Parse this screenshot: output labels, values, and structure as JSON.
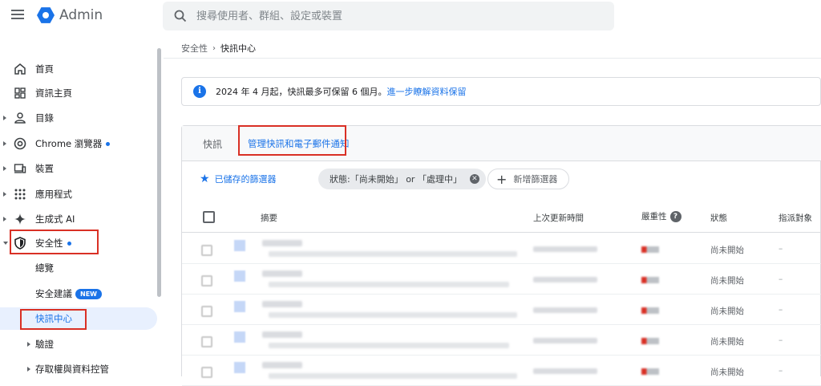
{
  "app": {
    "title": "Admin"
  },
  "search": {
    "placeholder": "搜尋使用者、群組、設定或裝置"
  },
  "sidebar": {
    "items": [
      {
        "label": "首頁"
      },
      {
        "label": "資訊主頁"
      },
      {
        "label": "目錄"
      },
      {
        "label": "Chrome 瀏覽器"
      },
      {
        "label": "裝置"
      },
      {
        "label": "應用程式"
      },
      {
        "label": "生成式 AI"
      },
      {
        "label": "安全性"
      }
    ],
    "security_sub": [
      {
        "label": "總覽"
      },
      {
        "label": "安全建議",
        "badge": "NEW"
      },
      {
        "label": "快訊中心"
      },
      {
        "label": "驗證"
      },
      {
        "label": "存取權與資料控管"
      }
    ]
  },
  "breadcrumb": {
    "parent": "安全性",
    "current": "快訊中心"
  },
  "info": {
    "text": "2024 年 4 月起，快訊最多可保留 6 個月。",
    "link": "進一步瞭解資料保留"
  },
  "tabs": {
    "alerts": "快訊",
    "manage": "管理快訊和電子郵件通知"
  },
  "filters": {
    "saved": "已儲存的篩選器",
    "chip": "狀態:「尚未開始」 or 「處理中」",
    "add": "新增篩選器"
  },
  "table": {
    "headers": {
      "summary": "摘要",
      "updated": "上次更新時間",
      "severity": "嚴重性",
      "status": "狀態",
      "assignee": "指派對象"
    },
    "rows": [
      {
        "status": "尚未開始",
        "assignee": "–"
      },
      {
        "status": "尚未開始",
        "assignee": "–"
      },
      {
        "status": "尚未開始",
        "assignee": "–"
      },
      {
        "status": "尚未開始",
        "assignee": "–"
      },
      {
        "status": "尚未開始",
        "assignee": "–"
      }
    ]
  },
  "colors": {
    "accent": "#1a73e8",
    "highlight": "#d93025"
  }
}
